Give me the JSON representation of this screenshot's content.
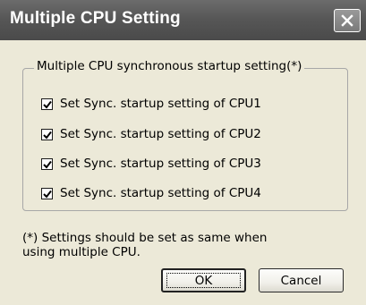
{
  "window": {
    "title": "Multiple CPU Setting",
    "close_icon": "close-icon"
  },
  "group": {
    "legend": "Multiple CPU synchronous startup setting(*)",
    "items": [
      {
        "label": "Set Sync. startup setting of CPU1",
        "checked": true
      },
      {
        "label": "Set Sync. startup setting of CPU2",
        "checked": true
      },
      {
        "label": "Set Sync. startup setting of CPU3",
        "checked": true
      },
      {
        "label": "Set Sync. startup setting of CPU4",
        "checked": true
      }
    ]
  },
  "note": {
    "line1": "(*) Settings should be set as same when",
    "line2": "using multiple CPU."
  },
  "buttons": {
    "ok_label": "OK",
    "cancel_label": "Cancel"
  },
  "colors": {
    "dialog_background": "#ece9d8",
    "titlebar": "#575757",
    "title_text": "#ffffff"
  }
}
